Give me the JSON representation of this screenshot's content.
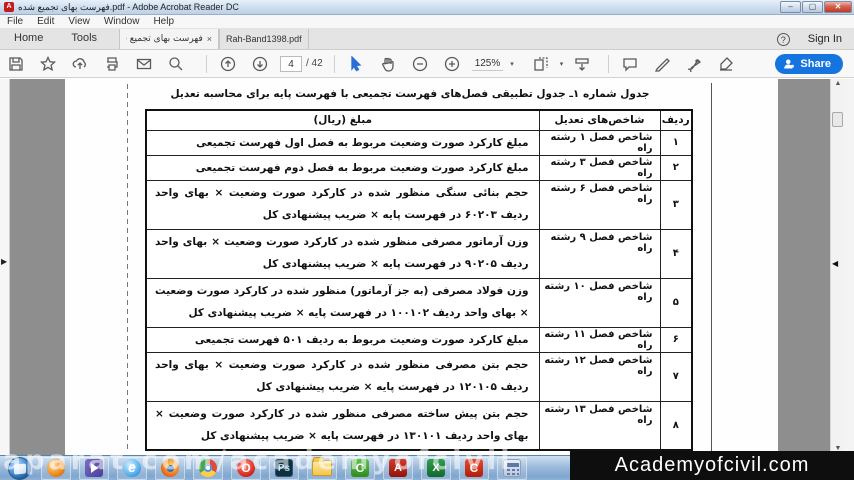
{
  "window": {
    "title": "فهرست بهای تجمیع شده.pdf - Adobe Acrobat Reader DC",
    "app_icon_letter": "A",
    "controls": {
      "minimize": "–",
      "maximize": "▢",
      "close": "✕"
    }
  },
  "menubar": {
    "items": [
      "File",
      "Edit",
      "View",
      "Window",
      "Help"
    ]
  },
  "tabbar": {
    "home_label": "Home",
    "tools_label": "Tools",
    "doc_tabs": [
      {
        "label": "فهرست بهای تجمیع شد...",
        "close_glyph": "×",
        "active": true
      },
      {
        "label": "Rah-Band1398.pdf",
        "active": false
      }
    ],
    "help_icon_glyph": "?",
    "sign_in_label": "Sign In"
  },
  "toolbar": {
    "page_current": "4",
    "page_total": "/ 42",
    "zoom_level": "125%",
    "caret_glyph": "▾",
    "share_label": "Share"
  },
  "document": {
    "title": "جدول شماره ۱ـ جدول تطبیقی فصل‌های فهرست تجمیعی با فهرست پایه برای محاسبه تعدیل",
    "table": {
      "headers": {
        "amount": "مبلغ (ریال)",
        "indicator": "شاخص‌های تعدیل",
        "row": "ردیف"
      },
      "rows": [
        {
          "index": "۱",
          "indicator": "شاخص فصل ۱ رشته راه",
          "amount": "مبلغ کارکرد صورت وضعیت مربوط به فصل اول فهرست تجمیعی",
          "tall": false
        },
        {
          "index": "۲",
          "indicator": "شاخص فصل ۳ رشته راه",
          "amount": "مبلغ کارکرد صورت وضعیت مربوط به فصل دوم فهرست تجمیعی",
          "tall": false
        },
        {
          "index": "۳",
          "indicator": "شاخص فصل ۶ رشته راه",
          "amount": "حجم بنائی سنگی منظور شده در کارکرد صورت وضعیت × بهای واحد ردیف ۶۰۲۰۳ در فهرست پایه × ضریب پیشنهادی کل",
          "tall": true
        },
        {
          "index": "۴",
          "indicator": "شاخص فصل ۹ رشته راه",
          "amount": "وزن آرماتور مصرفی منظور شده در کارکرد صورت وضعیت × بهای واحد ردیف ۹۰۲۰۵ در فهرست پایه × ضریب پیشنهادی کل",
          "tall": true
        },
        {
          "index": "۵",
          "indicator": "شاخص فصل ۱۰ رشته راه",
          "amount": "وزن فولاد مصرفی (به جز آرماتور) منظور شده در کارکرد صورت وضعیت × بهای واحد ردیف ۱۰۰۱۰۲ در فهرست پایه × ضریب پیشنهادی کل",
          "tall": true
        },
        {
          "index": "۶",
          "indicator": "شاخص فصل ۱۱ رشته راه",
          "amount": "مبلغ کارکرد صورت وضعیت مربوط به ردیف ۵۰۱ فهرست تجمیعی",
          "tall": false
        },
        {
          "index": "۷",
          "indicator": "شاخص فصل ۱۲ رشته راه",
          "amount": "حجم بتن مصرفی منظور شده در کارکرد صورت وضعیت × بهای واحد ردیف ۱۲۰۱۰۵ در فهرست پایه × ضریب پیشنهادی کل",
          "tall": true
        },
        {
          "index": "۸",
          "indicator": "شاخص فصل ۱۳ رشته راه",
          "amount": "حجم بتن پیش ساخته مصرفی منظور شده در کارکرد صورت وضعیت × بهای واحد ردیف ۱۳۰۱۰۱ در فهرست پایه × ضریب پیشنهادی کل",
          "tall": true
        }
      ]
    }
  },
  "taskbar": {
    "icons": [
      "start-orb",
      "media-player",
      "kmplayer",
      "internet-explorer",
      "firefox",
      "chrome",
      "opera",
      "photoshop",
      "explorer-folder",
      "camtasia-green",
      "adobe-reader",
      "excel",
      "camtasia-red",
      "calculator"
    ],
    "icon_letters": {
      "ie": "e",
      "photoshop": "Ps",
      "camtasia_green": "C",
      "adobe": "A",
      "excel": "X",
      "camtasia_red": "C",
      "opera": "O"
    },
    "watermark_overlay": "aparat.com/academyofcivil",
    "brand_box": "Academyofcivil.com"
  }
}
